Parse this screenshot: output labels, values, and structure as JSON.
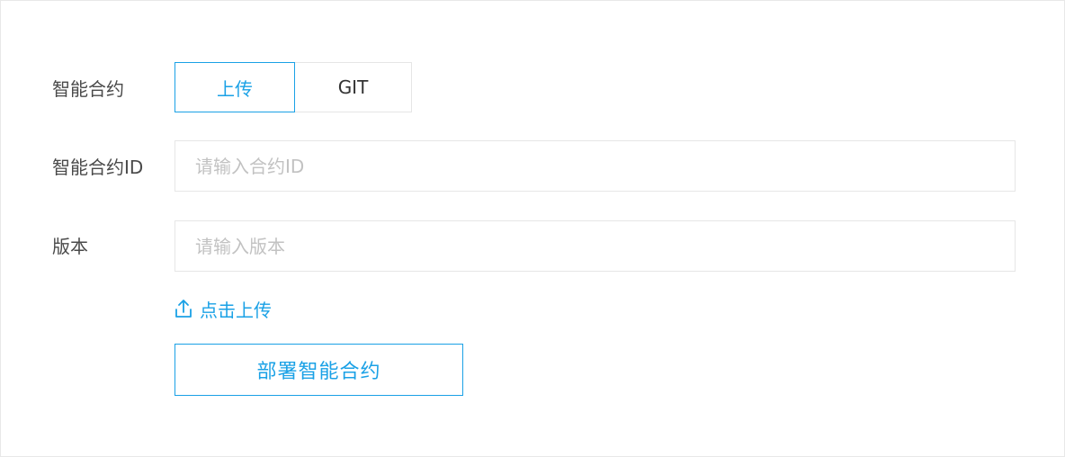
{
  "form": {
    "contract": {
      "label": "智能合约",
      "options": [
        "上传",
        "GIT"
      ],
      "selected": "上传"
    },
    "contract_id": {
      "label": "智能合约ID",
      "placeholder": "请输入合约ID",
      "value": ""
    },
    "version": {
      "label": "版本",
      "placeholder": "请输入版本",
      "value": ""
    },
    "upload_link": {
      "label": "点击上传",
      "icon": "upload-icon"
    },
    "deploy_button": {
      "label": "部署智能合约"
    }
  },
  "colors": {
    "accent": "#1aa1e6",
    "label_text": "#4a4a4a",
    "border": "#e6e6e6",
    "placeholder": "#c2c2c2"
  }
}
